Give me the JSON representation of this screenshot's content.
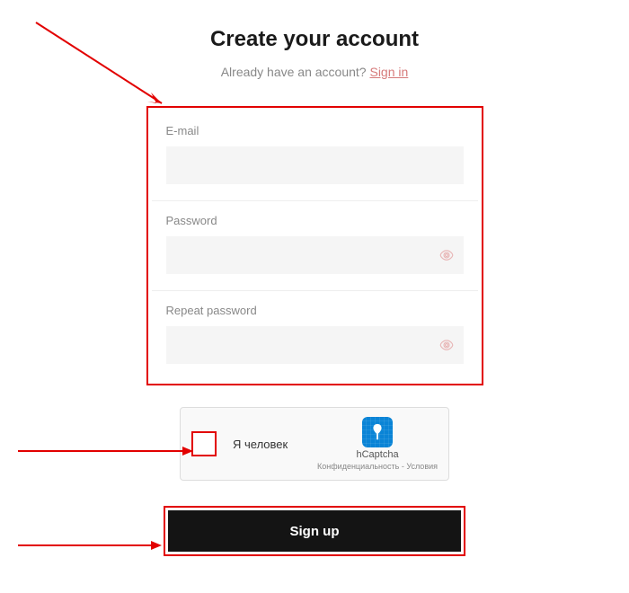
{
  "header": {
    "title": "Create your account",
    "subtitle_prefix": "Already have an account? ",
    "signin_link": "Sign in"
  },
  "form": {
    "email_label": "E-mail",
    "email_value": "",
    "password_label": "Password",
    "password_value": "",
    "repeat_password_label": "Repeat password",
    "repeat_password_value": ""
  },
  "captcha": {
    "label": "Я человек",
    "brand": "hCaptcha",
    "privacy": "Конфиденциальность",
    "separator": " - ",
    "terms": "Условия"
  },
  "actions": {
    "signup_label": "Sign up"
  }
}
